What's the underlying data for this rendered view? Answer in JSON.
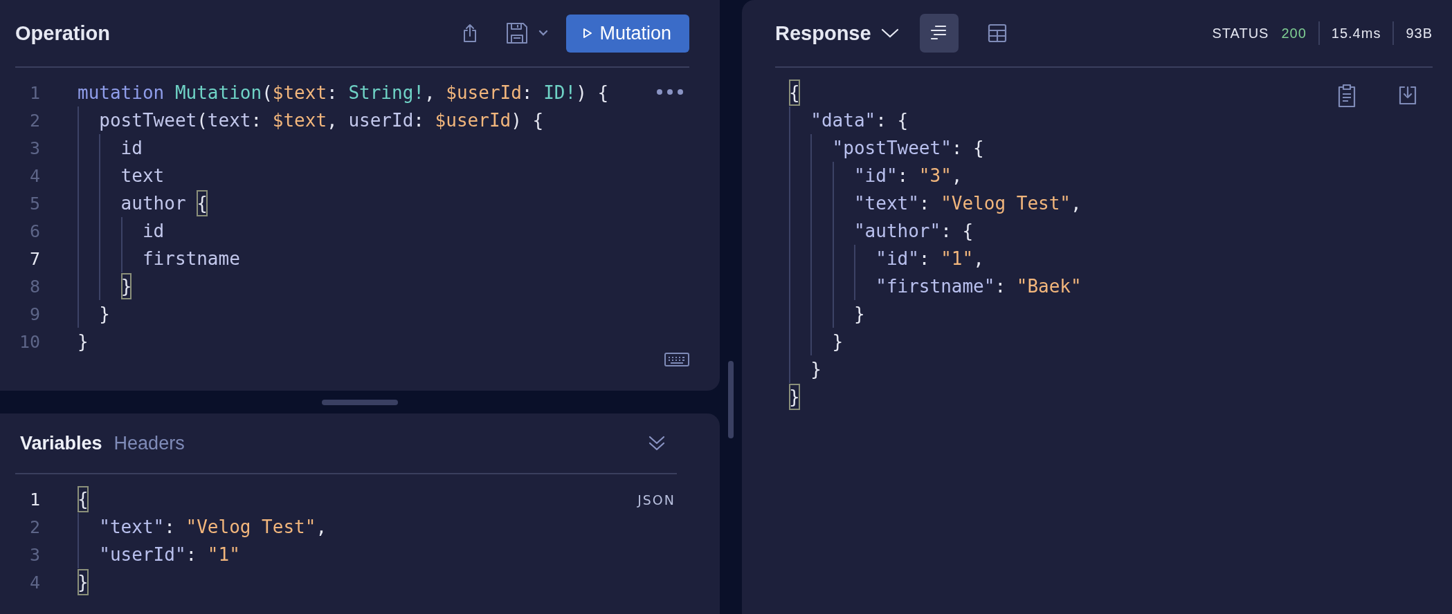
{
  "operation": {
    "title": "Operation",
    "run_button": {
      "label": "Mutation"
    },
    "lines": [
      {
        "number": "1",
        "current": false,
        "tokens": [
          {
            "text": "mutation ",
            "kind": "keyword"
          },
          {
            "text": "Mutation",
            "kind": "def"
          },
          {
            "text": "(",
            "kind": "punct"
          },
          {
            "text": "$text",
            "kind": "var"
          },
          {
            "text": ": ",
            "kind": "punct"
          },
          {
            "text": "String!",
            "kind": "type"
          },
          {
            "text": ", ",
            "kind": "punct"
          },
          {
            "text": "$userId",
            "kind": "var"
          },
          {
            "text": ": ",
            "kind": "punct"
          },
          {
            "text": "ID!",
            "kind": "type"
          },
          {
            "text": ") {",
            "kind": "punct"
          }
        ]
      },
      {
        "number": "2",
        "current": false,
        "tokens": [
          {
            "text": "  postTweet",
            "kind": "field"
          },
          {
            "text": "(",
            "kind": "punct"
          },
          {
            "text": "text",
            "kind": "field"
          },
          {
            "text": ": ",
            "kind": "punct"
          },
          {
            "text": "$text",
            "kind": "var"
          },
          {
            "text": ", ",
            "kind": "punct"
          },
          {
            "text": "userId",
            "kind": "field"
          },
          {
            "text": ": ",
            "kind": "punct"
          },
          {
            "text": "$userId",
            "kind": "var"
          },
          {
            "text": ") {",
            "kind": "punct"
          }
        ]
      },
      {
        "number": "3",
        "current": false,
        "tokens": [
          {
            "text": "    id",
            "kind": "field"
          }
        ]
      },
      {
        "number": "4",
        "current": false,
        "tokens": [
          {
            "text": "    text",
            "kind": "field"
          }
        ]
      },
      {
        "number": "5",
        "current": false,
        "tokens": [
          {
            "text": "    author ",
            "kind": "field"
          },
          {
            "text": "{",
            "kind": "matched_bracket"
          }
        ]
      },
      {
        "number": "6",
        "current": false,
        "tokens": [
          {
            "text": "      id",
            "kind": "field"
          }
        ]
      },
      {
        "number": "7",
        "current": true,
        "tokens": [
          {
            "text": "      firstname",
            "kind": "field"
          }
        ]
      },
      {
        "number": "8",
        "current": false,
        "tokens": [
          {
            "text": "    }",
            "kind": "matched_bracket"
          }
        ]
      },
      {
        "number": "9",
        "current": false,
        "tokens": [
          {
            "text": "  }",
            "kind": "punct"
          }
        ]
      },
      {
        "number": "10",
        "current": false,
        "tokens": [
          {
            "text": "}",
            "kind": "punct"
          }
        ]
      }
    ]
  },
  "variables_panel": {
    "tabs": [
      {
        "label": "Variables",
        "selected": true
      },
      {
        "label": "Headers",
        "selected": false
      }
    ],
    "badge": "JSON",
    "lines": [
      {
        "number": "1",
        "current": true,
        "tokens": [
          {
            "text": "{",
            "kind": "matched_bracket"
          }
        ]
      },
      {
        "number": "2",
        "current": false,
        "tokens": [
          {
            "text": "  \"text\"",
            "kind": "key"
          },
          {
            "text": ": ",
            "kind": "punct"
          },
          {
            "text": "\"Velog Test\"",
            "kind": "string"
          },
          {
            "text": ",",
            "kind": "punct"
          }
        ]
      },
      {
        "number": "3",
        "current": false,
        "tokens": [
          {
            "text": "  \"userId\"",
            "kind": "key"
          },
          {
            "text": ": ",
            "kind": "punct"
          },
          {
            "text": "\"1\"",
            "kind": "string"
          }
        ]
      },
      {
        "number": "4",
        "current": false,
        "tokens": [
          {
            "text": "}",
            "kind": "matched_bracket"
          }
        ]
      }
    ]
  },
  "response": {
    "title": "Response",
    "views": [
      {
        "kind": "formatted",
        "selected": true
      },
      {
        "kind": "table",
        "selected": false
      }
    ],
    "status_label": "STATUS",
    "status_code": "200",
    "time": "15.4ms",
    "size": "93B",
    "lines": [
      {
        "tokens": [
          {
            "text": "{",
            "kind": "matched_bracket"
          }
        ]
      },
      {
        "tokens": [
          {
            "text": "  \"data\"",
            "kind": "key"
          },
          {
            "text": ": {",
            "kind": "punct"
          }
        ]
      },
      {
        "tokens": [
          {
            "text": "    \"postTweet\"",
            "kind": "key"
          },
          {
            "text": ": {",
            "kind": "punct"
          }
        ]
      },
      {
        "tokens": [
          {
            "text": "      \"id\"",
            "kind": "key"
          },
          {
            "text": ": ",
            "kind": "punct"
          },
          {
            "text": "\"3\"",
            "kind": "string"
          },
          {
            "text": ",",
            "kind": "punct"
          }
        ]
      },
      {
        "tokens": [
          {
            "text": "      \"text\"",
            "kind": "key"
          },
          {
            "text": ": ",
            "kind": "punct"
          },
          {
            "text": "\"Velog Test\"",
            "kind": "string"
          },
          {
            "text": ",",
            "kind": "punct"
          }
        ]
      },
      {
        "tokens": [
          {
            "text": "      \"author\"",
            "kind": "key"
          },
          {
            "text": ": {",
            "kind": "punct"
          }
        ]
      },
      {
        "tokens": [
          {
            "text": "        \"id\"",
            "kind": "key"
          },
          {
            "text": ": ",
            "kind": "punct"
          },
          {
            "text": "\"1\"",
            "kind": "string"
          },
          {
            "text": ",",
            "kind": "punct"
          }
        ]
      },
      {
        "tokens": [
          {
            "text": "        \"firstname\"",
            "kind": "key"
          },
          {
            "text": ": ",
            "kind": "punct"
          },
          {
            "text": "\"Baek\"",
            "kind": "string"
          }
        ]
      },
      {
        "tokens": [
          {
            "text": "      }",
            "kind": "punct"
          }
        ]
      },
      {
        "tokens": [
          {
            "text": "    }",
            "kind": "punct"
          }
        ]
      },
      {
        "tokens": [
          {
            "text": "  }",
            "kind": "punct"
          }
        ]
      },
      {
        "tokens": [
          {
            "text": "}",
            "kind": "matched_bracket"
          }
        ]
      }
    ]
  }
}
